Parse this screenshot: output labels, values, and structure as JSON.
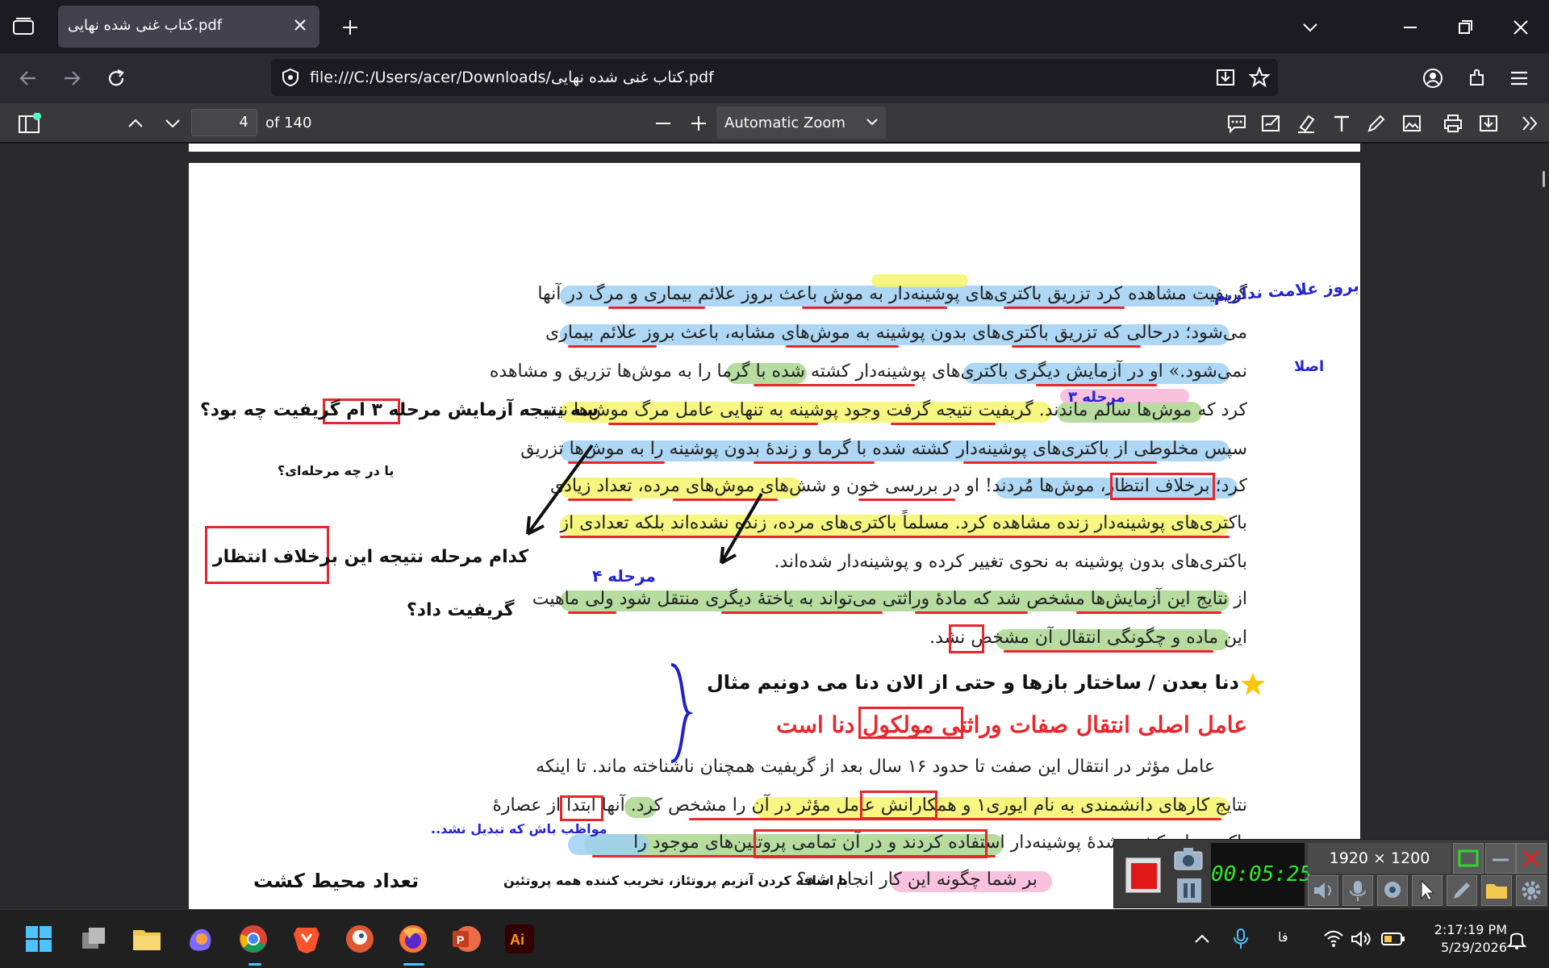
{
  "browser": {
    "tab_title": "کتاب غنی شده نهایی.pdf",
    "url": "file:///C:/Users/acer/Downloads/کتاب غنی شده نهایی.pdf"
  },
  "pdf_toolbar": {
    "page_number": "4",
    "page_count": "of 140",
    "zoom": "Automatic Zoom"
  },
  "document": {
    "lines": [
      "گریفیت مشاهده کرد تزریق باکتری‌های پوشینه‌دار به موش باعث بروز علائم بیماری و مرگ در آنها",
      "می‌شود؛ درحالی که تزریق باکتری‌های بدون پوشینه به موش‌های مشابه، باعث بروز علائم بیماری",
      "نمی‌شود.» او در آزمایش دیگری باکتری‌های پوشینه‌دار کشته شده با گرما را به موش‌ها تزریق و مشاهده",
      "کرد که موش‌ها سالم ماندند. گریفیت نتیجه گرفت وجود پوشینه به تنهایی عامل مرگ موش‌ها نیست.",
      "سپس مخلوطی از باکتری‌های پوشینه‌دار کشته شده با گرما و زندهٔ بدون پوشینه را به موش‌ها تزریق",
      "کرد؛ برخلاف انتظار، موش‌ها مُردند! او در بررسی خون و شش‌های موش‌های مرده، تعداد زیادی",
      "باکتری‌های پوشینه‌دار زنده مشاهده کرد. مسلماً باکتری‌های مرده، زنده نشده‌اند بلکه تعدادی از",
      "باکتری‌های بدون پوشینه به نحوی تغییر کرده و پوشینه‌دار شده‌اند.",
      "از نتایج این آزمایش‌ها مشخص شد که مادهٔ وراثتی می‌تواند به یاختهٔ دیگری منتقل شود ولی ماهیت",
      "این ماده و چگونگی انتقال آن مشخص نشد.",
      "عامل مؤثر در انتقال این صفت تا حدود ۱۶ سال بعد از گریفیت همچنان ناشناخته ماند. تا اینکه",
      "نتایج کارهای دانشمندی به نام ایوری۱ و همکارانش عامل مؤثر در آن را مشخص کرد. آنها ابتدا از عصارهٔ",
      "باکتری‌های کشته شدهٔ پوشینه‌دار استفاده کردند و در آن تمامی پروتئین‌های موجود را",
      "بر شما چگونه این کار انجام شد؟"
    ],
    "heading_red": "عامل اصلی انتقال صفات وراثتی مولکول دنا است",
    "heading_black": "دنا بعدن / ساختار بازها و حتی از الان دنا می دونیم مثال",
    "notes": {
      "n1": "بروز علامت نداریم",
      "n2": "اصلا",
      "n3": "مرحله ۳",
      "n4": "سه نتیجه آزمایش مرحله ۳ ام گریفیت چه بود؟",
      "n5": "یا در چه مرحله‌ای؟",
      "n6": "کدام مرحله نتیجه این برخلاف انتظار",
      "n7": "گریفیت داد؟",
      "n8": "مرحله ۴",
      "n9": "مواظب باش که تبدیل نشد..",
      "n10": "تعداد محیط کشت",
      "n11": "با اضافه کردن آنزیم پروتئاز، تخریب کننده همه پروتئین"
    }
  },
  "recorder": {
    "timer": "00:05:25",
    "resolution": "1920 × 1200"
  },
  "taskbar": {
    "lang": "فا",
    "time": "2:17:19 PM",
    "date": "5/29/2026"
  }
}
